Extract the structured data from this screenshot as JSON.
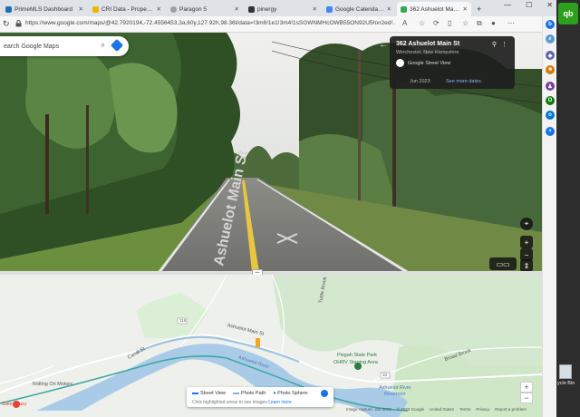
{
  "tabs": [
    {
      "label": "PrimeMLS Dashboard",
      "color": "#1f6fb5"
    },
    {
      "label": "CRI Data - Property Rec",
      "color": "#f4b400"
    },
    {
      "label": "Paragon 5",
      "color": "#9aa0a6"
    },
    {
      "label": "pinergy",
      "color": "#333333"
    },
    {
      "label": "Google Calendar - Octo",
      "color": "#4285f4"
    },
    {
      "label": "362 Ashuelot Main St - G",
      "color": "#34a853"
    }
  ],
  "address_bar": {
    "url": "https://www.google.com/maps/@42.7920194,-72.4556453,3a,60y,127.92h,98.36t/data=!3m6!1e1!3m4!1sSGWNMHcOWB55ON92U5hxr2ed!..."
  },
  "street_view": {
    "search_placeholder": "earch Google Maps",
    "road_text": "Ashuelot Main St",
    "card": {
      "title": "362 Ashuelot Main St",
      "subtitle": "Winchester, New Hampshire",
      "brand": "Google Street View",
      "date": "Jun 2023",
      "more_dates": "See more dates"
    }
  },
  "map": {
    "labels": {
      "winchester": "Ashuelot Main St",
      "ashuelot_river": "Ashuelot River",
      "pisgah": "Pisgah State Park",
      "ohrv": "OHRV Staging Area",
      "reservoir_a": "Ashuelot River",
      "reservoir_b": "Reservoir",
      "rolling_on": "Rolling On Motors",
      "gale": "Gale Crazy",
      "broad_brook": "Broad Brook",
      "road_10": "10",
      "road_119": "119",
      "canal_st": "Canal St",
      "tuttle_brook": "Tuttle Brook"
    },
    "legend": {
      "street_view": "Street View",
      "photo_path": "Photo Path",
      "photo_sphere": "Photo Sphere",
      "hint": "Click highlighted areas to see images",
      "learn_more": "Learn more"
    },
    "footer": {
      "capture": "Image capture: Jun 2023",
      "copyright": "© 2023 Google",
      "states": "United States",
      "terms": "Terms",
      "privacy": "Privacy",
      "report": "Report a problem"
    }
  },
  "desktop": {
    "qb_label": "qb",
    "recycle_label": "ycle Bin"
  }
}
